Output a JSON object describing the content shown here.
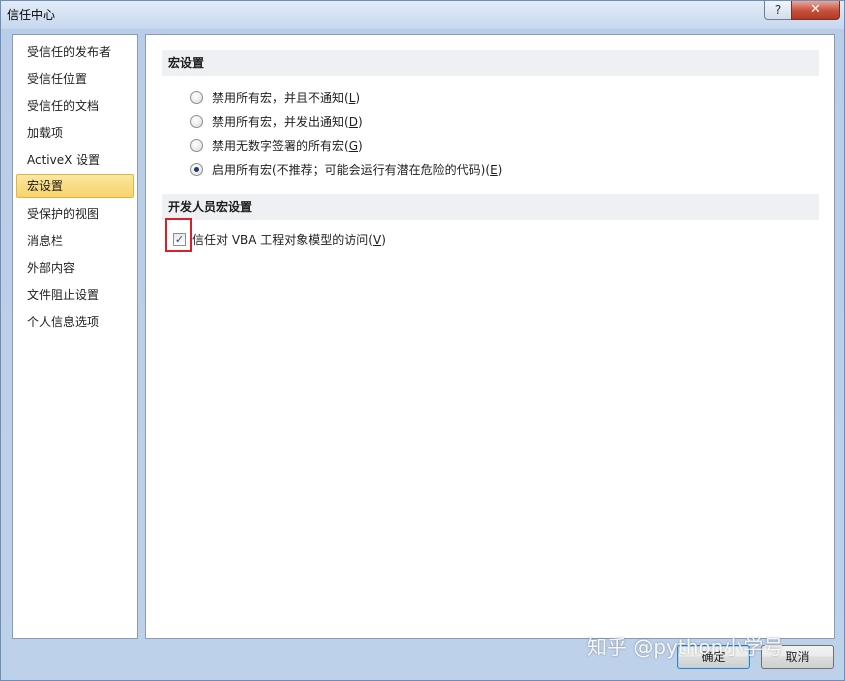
{
  "window": {
    "title": "信任中心",
    "help_label": "?",
    "close_label": "✕"
  },
  "sidebar": {
    "items": [
      {
        "label": "受信任的发布者"
      },
      {
        "label": "受信任位置"
      },
      {
        "label": "受信任的文档"
      },
      {
        "label": "加载项"
      },
      {
        "label": "ActiveX 设置"
      },
      {
        "label": "宏设置",
        "selected": true
      },
      {
        "label": "受保护的视图"
      },
      {
        "label": "消息栏"
      },
      {
        "label": "外部内容"
      },
      {
        "label": "文件阻止设置"
      },
      {
        "label": "个人信息选项"
      }
    ]
  },
  "macro_settings": {
    "header": "宏设置",
    "options": [
      {
        "text": "禁用所有宏，并且不通知(",
        "key": "L",
        "suffix": ")",
        "checked": false
      },
      {
        "text": "禁用所有宏，并发出通知(",
        "key": "D",
        "suffix": ")",
        "checked": false
      },
      {
        "text": "禁用无数字签署的所有宏(",
        "key": "G",
        "suffix": ")",
        "checked": false
      },
      {
        "text": "启用所有宏(不推荐；可能会运行有潜在危险的代码)(",
        "key": "E",
        "suffix": ")",
        "checked": true
      }
    ]
  },
  "developer_settings": {
    "header": "开发人员宏设置",
    "checkbox": {
      "text": "信任对 VBA 工程对象模型的访问(",
      "key": "V",
      "suffix": ")",
      "checked": true,
      "check_glyph": "✓"
    }
  },
  "footer": {
    "ok_label": "确定",
    "cancel_label": "取消"
  },
  "watermark": "知乎 @python小学号",
  "colors": {
    "selected_bg": "#f7d36a",
    "highlight_border": "#d9202a"
  }
}
